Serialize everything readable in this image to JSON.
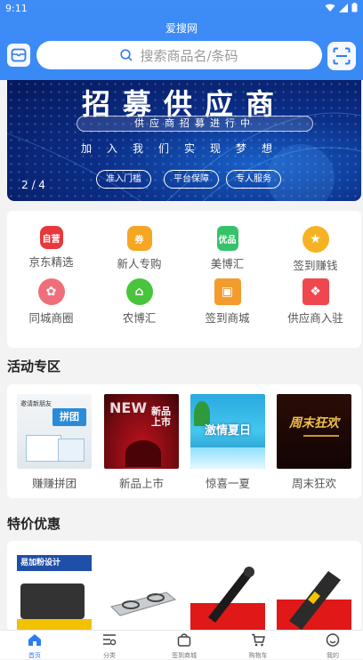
{
  "status_bar": {
    "time": "9:11"
  },
  "header": {
    "title": "爱搜网",
    "search_placeholder": "搜索商品名/条码"
  },
  "banner": {
    "headline": "招募供应商",
    "subheadline": "供应商招募进行中",
    "slogan": "加入我们实现梦想",
    "tags": [
      "准入门槛",
      "平台保障",
      "专人服务"
    ],
    "counter": "2 / 4"
  },
  "menu": [
    {
      "label": "京东精选",
      "icon": "jd-self-operated-icon",
      "badge": "自营",
      "color": "#e8383b"
    },
    {
      "label": "新人专购",
      "icon": "coupon-icon",
      "badge": "券",
      "color": "#f5a623"
    },
    {
      "label": "美博汇",
      "icon": "excellent-product-icon",
      "badge": "优品",
      "color": "#36c26b"
    },
    {
      "label": "签到赚钱",
      "icon": "star-coin-icon",
      "badge": "★",
      "color": "#f5b324"
    },
    {
      "label": "同城商圈",
      "icon": "local-circle-icon",
      "badge": "✿",
      "color": "#ef6e7a"
    },
    {
      "label": "农博汇",
      "icon": "basket-icon",
      "badge": "⌂",
      "color": "#49c43c"
    },
    {
      "label": "签到商城",
      "icon": "boxes-icon",
      "badge": "▣",
      "color": "#f39c2e"
    },
    {
      "label": "供应商入驻",
      "icon": "gift-icon",
      "badge": "❖",
      "color": "#f0474f"
    }
  ],
  "activity_section": {
    "title": "活动专区",
    "items": [
      {
        "label": "赚赚拼团",
        "overlay": "拼团",
        "top_text": "邀请新朋友"
      },
      {
        "label": "新品上市",
        "overlay": "新品上市",
        "top_text": "NEW"
      },
      {
        "label": "惊喜一夏",
        "overlay": "激情夏日",
        "top_text": ""
      },
      {
        "label": "周末狂欢",
        "overlay": "周末狂欢",
        "top_text": ""
      }
    ]
  },
  "deals_section": {
    "title": "特价优惠",
    "items": [
      {
        "name": "易加粉设计",
        "icon": "printer-toner-image"
      },
      {
        "name": "",
        "icon": "gas-stove-image"
      },
      {
        "name": "",
        "icon": "flashlight-image"
      },
      {
        "name": "",
        "icon": "torch-image"
      }
    ]
  },
  "tabbar": [
    {
      "label": "首页",
      "icon": "home-icon",
      "active": true
    },
    {
      "label": "分类",
      "icon": "category-icon",
      "active": false
    },
    {
      "label": "签到商城",
      "icon": "shop-bag-icon",
      "active": false
    },
    {
      "label": "购物车",
      "icon": "cart-icon",
      "active": false
    },
    {
      "label": "我的",
      "icon": "user-face-icon",
      "active": false
    }
  ]
}
